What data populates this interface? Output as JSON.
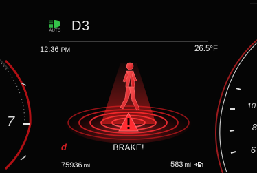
{
  "header": {
    "headlight_icon": "auto-headlight-icon",
    "headlight_label": "AUTO",
    "gear": "D3"
  },
  "info": {
    "time": "12:36",
    "time_suffix": "PM",
    "outside_temp": "26.5°F"
  },
  "alert": {
    "icon": "pedestrian-detection-warning-icon",
    "message": "BRAKE!"
  },
  "drive_mode": "d",
  "trip": {
    "odometer_value": "75936",
    "odometer_unit": "mi",
    "range_value": "583",
    "range_unit": "mi",
    "range_icon": "fuel-pump-icon"
  },
  "gauges": {
    "left_visible_label": "7",
    "right_visible_labels": [
      "10",
      "8",
      "6"
    ]
  },
  "colors": {
    "alert_red": "#d81e24",
    "headlight_green": "#35c24a",
    "text": "#e8e8e8"
  }
}
